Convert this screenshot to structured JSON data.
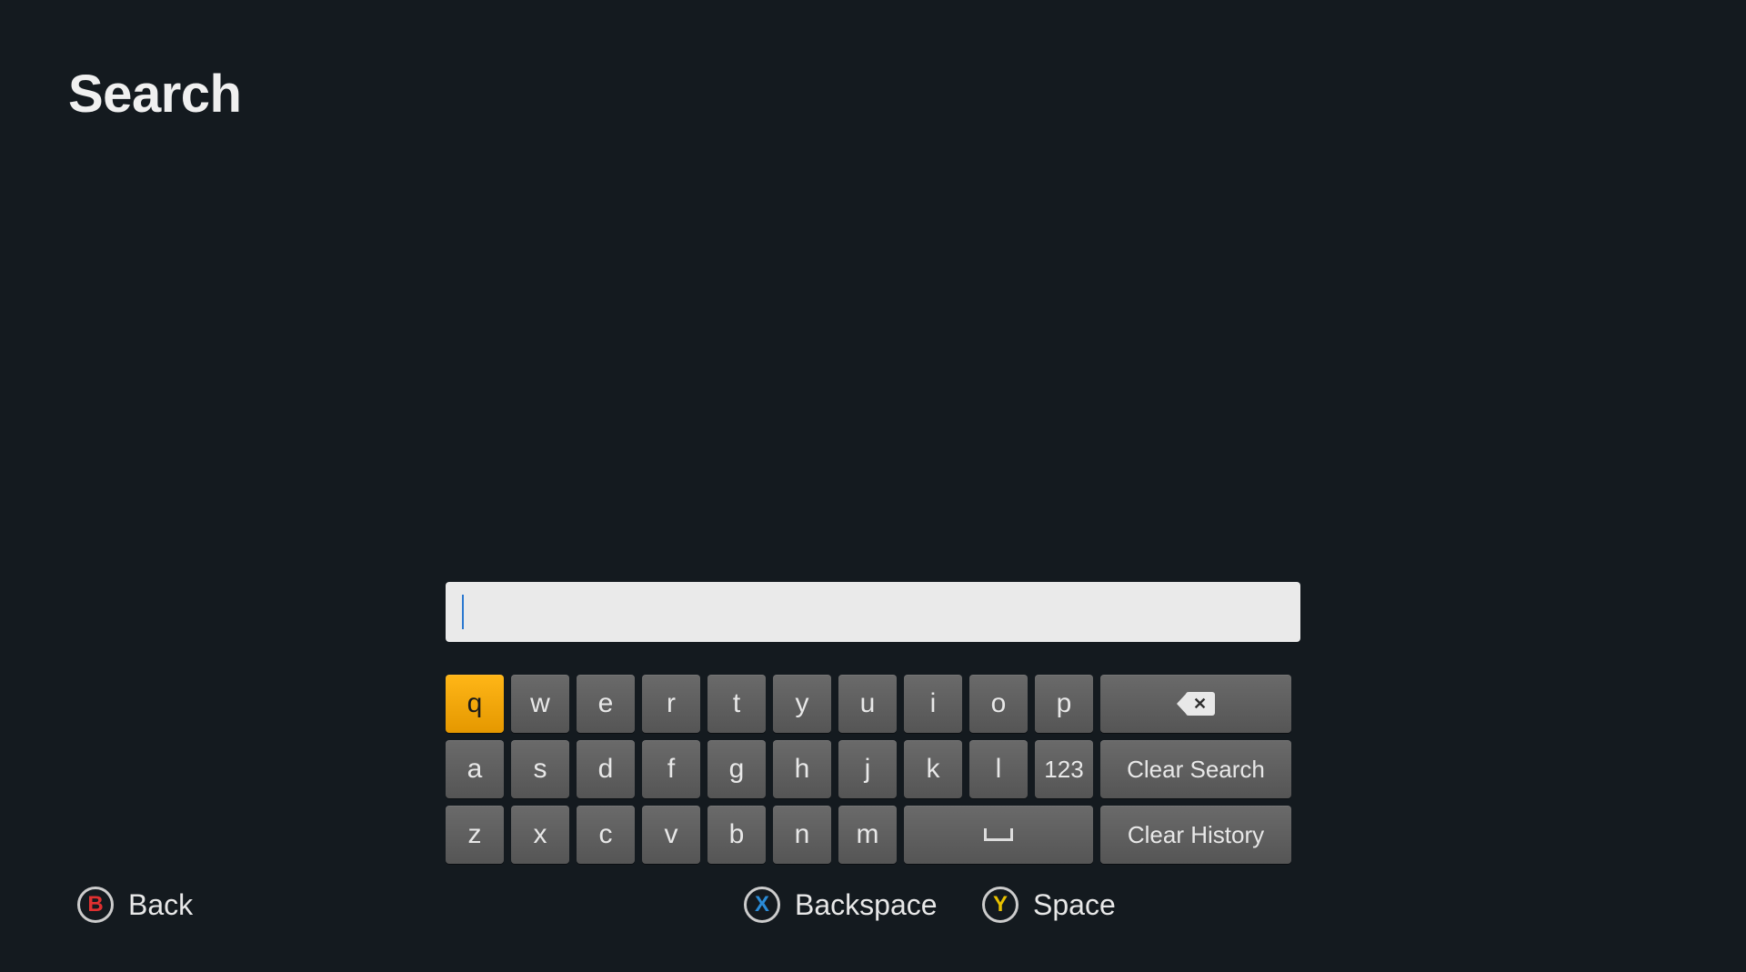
{
  "title": "Search",
  "search": {
    "value": ""
  },
  "keyboard": {
    "selected_key": "q",
    "rows": [
      {
        "letters": [
          "q",
          "w",
          "e",
          "r",
          "t",
          "y",
          "u",
          "i",
          "o",
          "p"
        ],
        "extra": {
          "type": "backspace"
        }
      },
      {
        "letters": [
          "a",
          "s",
          "d",
          "f",
          "g",
          "h",
          "j",
          "k",
          "l"
        ],
        "num_key": "123",
        "extra": {
          "type": "action",
          "label": "Clear Search"
        }
      },
      {
        "letters": [
          "z",
          "x",
          "c",
          "v",
          "b",
          "n",
          "m"
        ],
        "space": true,
        "extra": {
          "type": "action",
          "label": "Clear History"
        }
      }
    ]
  },
  "hints": {
    "back": {
      "button": "B",
      "label": "Back"
    },
    "backspace": {
      "button": "X",
      "label": "Backspace"
    },
    "space": {
      "button": "Y",
      "label": "Space"
    }
  }
}
